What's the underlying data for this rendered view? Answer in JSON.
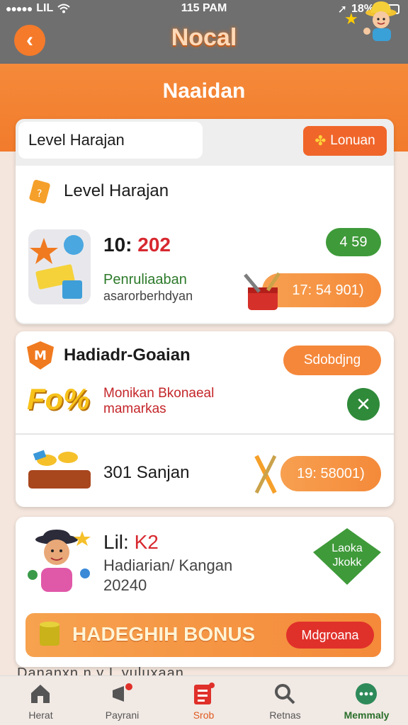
{
  "status_bar": {
    "carrier": "LIL",
    "time": "115 PAM",
    "battery": "18%"
  },
  "app_bar": {
    "back_symbol": "‹",
    "title": "Nocal"
  },
  "header": {
    "heading": "Naaidan"
  },
  "card1": {
    "tab_label": "Level Harajan",
    "button_label": "Lonuan",
    "item_title": "Level Harajan",
    "number_prefix": "10: ",
    "number_highlight": "202",
    "green_pill": "4 59",
    "line1": "Penruliaaban",
    "line2": "asarorberhdyan",
    "orange_pill": "17: 54 901)"
  },
  "card2": {
    "title": "Hadiadr-Goaian",
    "button_label": "Sdobdjng",
    "promo_graphic": "Fo%",
    "red_line1": "Monikan Bkonaeal",
    "red_line2": "mamarkas",
    "close_symbol": "✕",
    "row_label": "301 Sanjan",
    "orange_pill": "19: 58001)"
  },
  "card3": {
    "name_prefix": "Lil: ",
    "name_highlight": "K2",
    "subtitle": "Hadiarian/ Kangan",
    "number": "20240",
    "badge_line1": "Laoka",
    "badge_line2": "Jkokk",
    "bonus_label": "HADEGHIH BONUS",
    "bonus_button": "Mdgroana"
  },
  "footer_cut": "Dananxn n y  L yuluxaan",
  "bottom_nav": [
    {
      "label": "Herat",
      "icon": "home-icon"
    },
    {
      "label": "Payrani",
      "icon": "megaphone-icon"
    },
    {
      "label": "Srob",
      "icon": "list-icon"
    },
    {
      "label": "Retnas",
      "icon": "search-icon"
    },
    {
      "label": "Memmaly",
      "icon": "more-icon"
    }
  ],
  "colors": {
    "accent": "#f48a3a",
    "green": "#3f9a3a",
    "red": "#d7282f",
    "gray_bar": "#6f6f6f"
  }
}
